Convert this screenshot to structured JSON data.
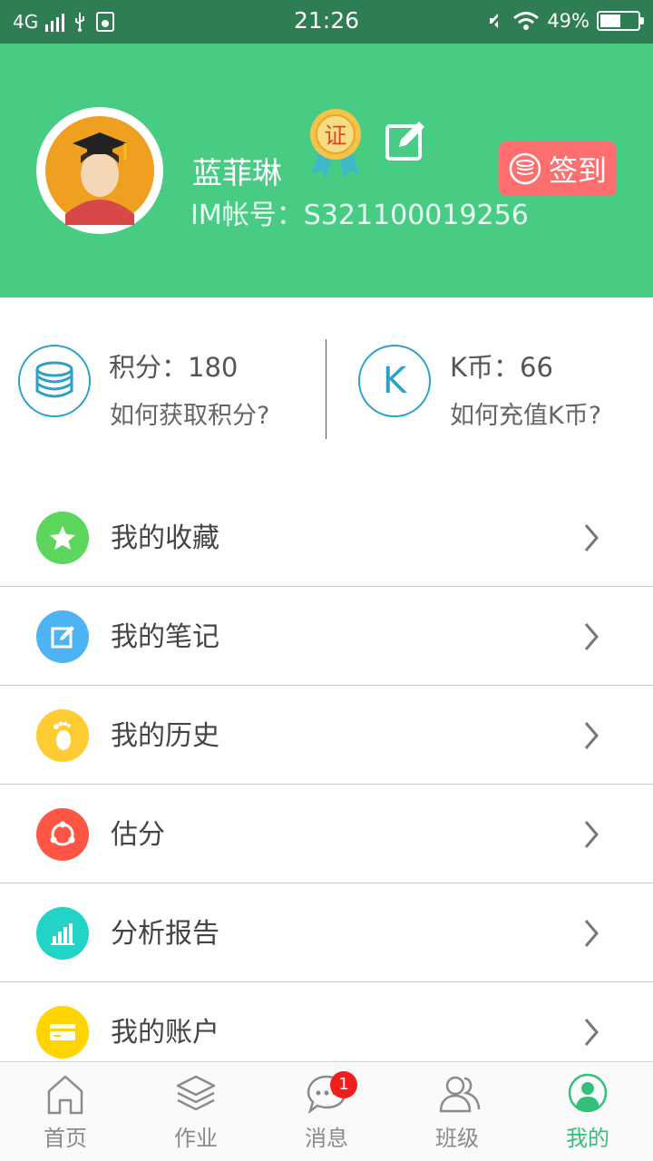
{
  "status_bar": {
    "network": "4G",
    "time": "21:26",
    "battery": "49%"
  },
  "profile": {
    "name": "蓝菲琳",
    "im_account": "IM帐号：S321100019256",
    "medal_text": "证",
    "signin_label": "签到"
  },
  "stats": {
    "points_label": "积分：180",
    "points_link": "如何获取积分?",
    "coins_icon_letter": "K",
    "coins_label": "K币：66",
    "coins_link": "如何充值K币?"
  },
  "menu": [
    {
      "label": "我的收藏",
      "icon": "star-icon",
      "color": "#5cd65c"
    },
    {
      "label": "我的笔记",
      "icon": "note-icon",
      "color": "#4db3f2"
    },
    {
      "label": "我的历史",
      "icon": "footprint-icon",
      "color": "#ffcc33"
    },
    {
      "label": "估分",
      "icon": "circle-nodes-icon",
      "color": "#ff5544"
    },
    {
      "label": "分析报告",
      "icon": "bar-chart-icon",
      "color": "#22d4c8"
    },
    {
      "label": "我的账户",
      "icon": "card-icon",
      "color": "#ffd400"
    }
  ],
  "bottom_nav": [
    {
      "label": "首页",
      "icon": "home-icon"
    },
    {
      "label": "作业",
      "icon": "layers-icon"
    },
    {
      "label": "消息",
      "icon": "chat-icon",
      "badge": "1"
    },
    {
      "label": "班级",
      "icon": "people-icon"
    },
    {
      "label": "我的",
      "icon": "user-icon",
      "active": true
    }
  ],
  "colors": {
    "header_bg": "#48cc84",
    "status_bg": "#2f7d52",
    "signin_bg": "#ff6f6f",
    "accent": "#2aa1c8",
    "nav_active": "#34c07a"
  }
}
